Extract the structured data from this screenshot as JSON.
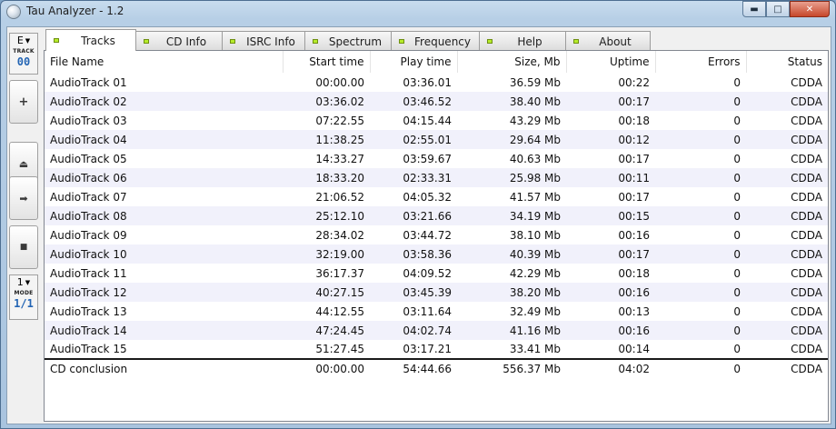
{
  "window": {
    "title": "Tau Analyzer - 1.2"
  },
  "sidebar": {
    "drive_letter": "E",
    "track_label": "TRACK",
    "track_number": "00",
    "buttons": [
      {
        "name": "add-button",
        "icon": "plus-icon",
        "glyph": "+"
      },
      {
        "name": "eject-button",
        "icon": "eject-icon",
        "glyph": "⏏"
      },
      {
        "name": "play-button",
        "icon": "arrow-right-icon",
        "glyph": "➡"
      },
      {
        "name": "stop-button",
        "icon": "stop-icon",
        "glyph": "■"
      }
    ],
    "mode_value": "1",
    "mode_label": "MODE",
    "mode_fraction": "1/1"
  },
  "tabs": [
    {
      "label": "Tracks",
      "active": true
    },
    {
      "label": "CD Info",
      "active": false
    },
    {
      "label": "ISRC Info",
      "active": false
    },
    {
      "label": "Spectrum",
      "active": false
    },
    {
      "label": "Frequency",
      "active": false
    },
    {
      "label": "Help",
      "active": false
    },
    {
      "label": "About",
      "active": false
    }
  ],
  "table": {
    "columns": [
      "File Name",
      "Start time",
      "Play time",
      "Size, Mb",
      "Uptime",
      "Errors",
      "Status"
    ],
    "rows": [
      [
        "AudioTrack 01",
        "00:00.00",
        "03:36.01",
        "36.59 Mb",
        "00:22",
        "0",
        "CDDA"
      ],
      [
        "AudioTrack 02",
        "03:36.02",
        "03:46.52",
        "38.40 Mb",
        "00:17",
        "0",
        "CDDA"
      ],
      [
        "AudioTrack 03",
        "07:22.55",
        "04:15.44",
        "43.29 Mb",
        "00:18",
        "0",
        "CDDA"
      ],
      [
        "AudioTrack 04",
        "11:38.25",
        "02:55.01",
        "29.64 Mb",
        "00:12",
        "0",
        "CDDA"
      ],
      [
        "AudioTrack 05",
        "14:33.27",
        "03:59.67",
        "40.63 Mb",
        "00:17",
        "0",
        "CDDA"
      ],
      [
        "AudioTrack 06",
        "18:33.20",
        "02:33.31",
        "25.98 Mb",
        "00:11",
        "0",
        "CDDA"
      ],
      [
        "AudioTrack 07",
        "21:06.52",
        "04:05.32",
        "41.57 Mb",
        "00:17",
        "0",
        "CDDA"
      ],
      [
        "AudioTrack 08",
        "25:12.10",
        "03:21.66",
        "34.19 Mb",
        "00:15",
        "0",
        "CDDA"
      ],
      [
        "AudioTrack 09",
        "28:34.02",
        "03:44.72",
        "38.10 Mb",
        "00:16",
        "0",
        "CDDA"
      ],
      [
        "AudioTrack 10",
        "32:19.00",
        "03:58.36",
        "40.39 Mb",
        "00:17",
        "0",
        "CDDA"
      ],
      [
        "AudioTrack 11",
        "36:17.37",
        "04:09.52",
        "42.29 Mb",
        "00:18",
        "0",
        "CDDA"
      ],
      [
        "AudioTrack 12",
        "40:27.15",
        "03:45.39",
        "38.20 Mb",
        "00:16",
        "0",
        "CDDA"
      ],
      [
        "AudioTrack 13",
        "44:12.55",
        "03:11.64",
        "32.49 Mb",
        "00:13",
        "0",
        "CDDA"
      ],
      [
        "AudioTrack 14",
        "47:24.45",
        "04:02.74",
        "41.16 Mb",
        "00:16",
        "0",
        "CDDA"
      ],
      [
        "AudioTrack 15",
        "51:27.45",
        "03:17.21",
        "33.41 Mb",
        "00:14",
        "0",
        "CDDA"
      ]
    ],
    "summary": [
      "CD conclusion",
      "00:00.00",
      "54:44.66",
      "556.37 Mb",
      "04:02",
      "0",
      "CDDA"
    ]
  }
}
